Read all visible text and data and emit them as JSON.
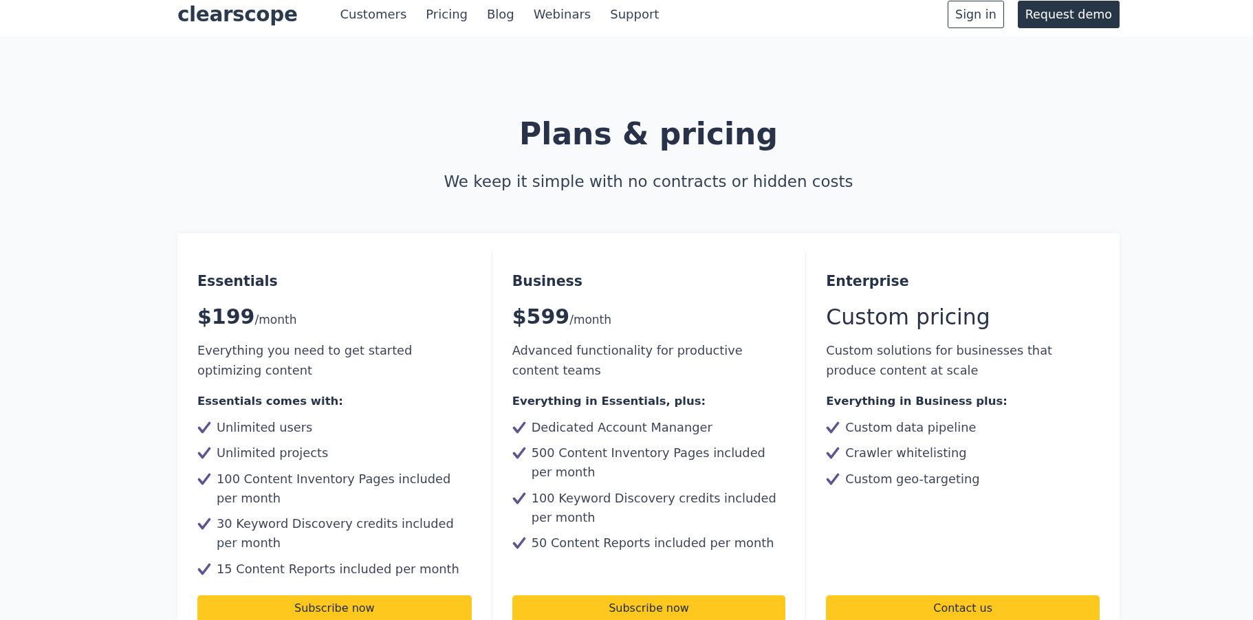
{
  "header": {
    "logo": "clearscope",
    "nav": [
      "Customers",
      "Pricing",
      "Blog",
      "Webinars",
      "Support"
    ],
    "sign_in": "Sign in",
    "request_demo": "Request demo"
  },
  "hero": {
    "title": "Plans & pricing",
    "subtitle": "We keep it simple with no contracts or hidden costs"
  },
  "plans": [
    {
      "name": "Essentials",
      "kind": "priced",
      "price": "$199",
      "period": "/month",
      "description": "Everything you need to get started optimizing content",
      "features_heading": "Essentials comes with:",
      "features": [
        "Unlimited users",
        "Unlimited projects",
        "100 Content Inventory Pages included per month",
        "30 Keyword Discovery credits included per month",
        "15 Content Reports included per month"
      ],
      "button": "Subscribe now"
    },
    {
      "name": "Business",
      "kind": "priced",
      "price": "$599",
      "period": "/month",
      "description": "Advanced functionality for productive content teams",
      "features_heading": "Everything in Essentials, plus:",
      "features": [
        "Dedicated Account Mananger",
        "500 Content Inventory Pages included per month",
        "100 Keyword Discovery credits included per month",
        "50 Content Reports included per month"
      ],
      "button": "Subscribe now"
    },
    {
      "name": "Enterprise",
      "kind": "custom",
      "price": "Custom pricing",
      "description": "Custom solutions for businesses that produce content at scale",
      "features_heading": "Everything in Business plus:",
      "features": [
        "Custom data pipeline",
        "Crawler whitelisting",
        "Custom geo-targeting"
      ],
      "button": "Contact us"
    }
  ]
}
